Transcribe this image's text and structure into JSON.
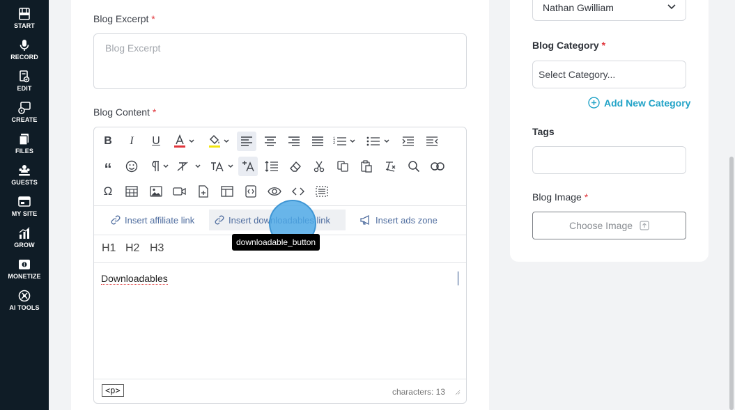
{
  "sidebar": {
    "items": [
      {
        "label": "START",
        "icon": "film-icon"
      },
      {
        "label": "RECORD",
        "icon": "microphone-icon"
      },
      {
        "label": "EDIT",
        "icon": "edit-document-icon"
      },
      {
        "label": "CREATE",
        "icon": "create-media-icon"
      },
      {
        "label": "FILES",
        "icon": "files-icon"
      },
      {
        "label": "GUESTS",
        "icon": "guests-icon"
      },
      {
        "label": "MY SITE",
        "icon": "website-icon"
      },
      {
        "label": "GROW",
        "icon": "bar-chart-icon"
      },
      {
        "label": "MONETIZE",
        "icon": "money-icon"
      },
      {
        "label": "AI TOOLS",
        "icon": "ai-tools-icon"
      }
    ]
  },
  "form": {
    "excerpt_label": "Blog Excerpt",
    "excerpt_placeholder": "Blog Excerpt",
    "content_label": "Blog Content",
    "required_mark": "*"
  },
  "editor": {
    "insert_links": {
      "affiliate": "Insert affiliate link",
      "downloadables": "Insert downloadables link",
      "ads": "Insert ads zone"
    },
    "tooltip": "downloadable_button",
    "headings": [
      "H1",
      "H2",
      "H3"
    ],
    "content": "Downloadables",
    "path_tag": "<p>",
    "char_count": "characters: 13"
  },
  "side": {
    "author_value": "Nathan Gwilliam",
    "category_label": "Blog Category",
    "category_placeholder": "Select Category...",
    "add_category": "Add New Category",
    "tags_label": "Tags",
    "image_label": "Blog Image",
    "choose_image": "Choose Image"
  },
  "colors": {
    "sidebar_bg": "#0f1c26",
    "accent": "#22a3c7",
    "required": "#e0353b",
    "click_marker": "#4aa7e6"
  }
}
